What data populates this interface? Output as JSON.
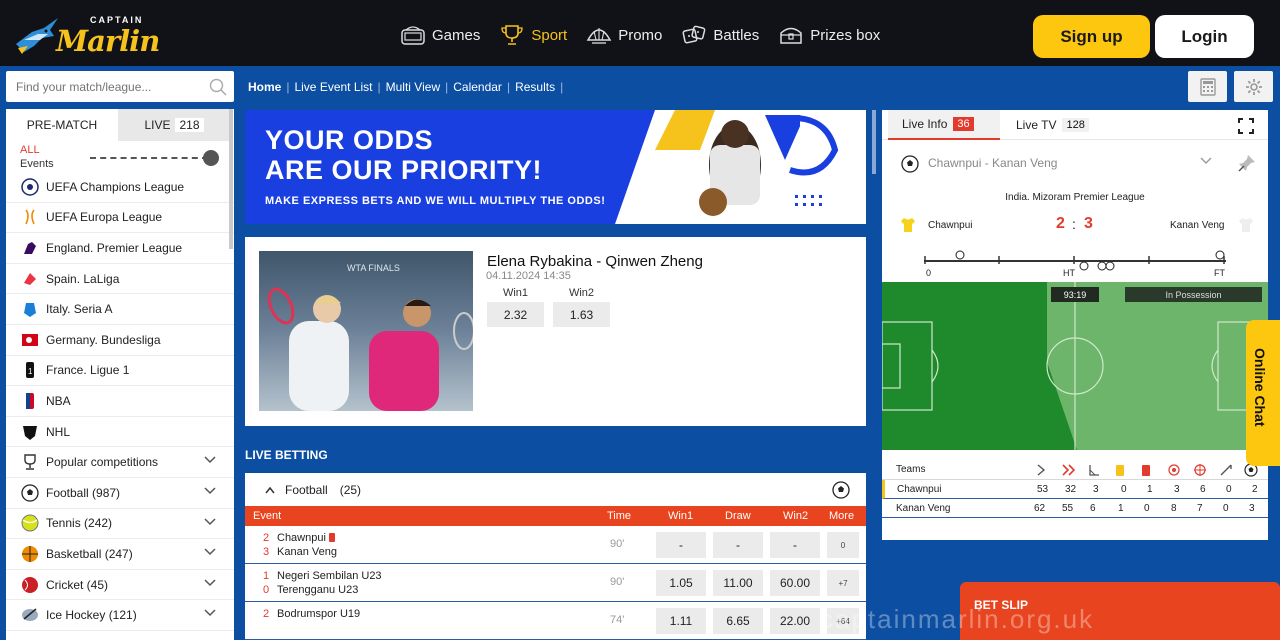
{
  "brand": {
    "top": "CAPTAIN",
    "main": "Marlin"
  },
  "nav": [
    {
      "label": "Games",
      "icon": "slot-machine-icon"
    },
    {
      "label": "Sport",
      "icon": "trophy-icon",
      "active": true
    },
    {
      "label": "Promo",
      "icon": "shell-icon"
    },
    {
      "label": "Battles",
      "icon": "dice-icon"
    },
    {
      "label": "Prizes box",
      "icon": "chest-icon"
    }
  ],
  "auth": {
    "signup": "Sign up",
    "login": "Login"
  },
  "search": {
    "placeholder": "Find your match/league..."
  },
  "sidebar": {
    "tabs": {
      "prematch": "PRE-MATCH",
      "live": "LIVE",
      "live_count": "218"
    },
    "all": "ALL",
    "events": "Events",
    "items": [
      {
        "label": "UEFA Champions League",
        "icon": "champions-league-icon"
      },
      {
        "label": "UEFA Europa League",
        "icon": "europa-league-icon"
      },
      {
        "label": "England. Premier League",
        "icon": "premier-league-icon"
      },
      {
        "label": "Spain. LaLiga",
        "icon": "laliga-icon"
      },
      {
        "label": "Italy. Seria A",
        "icon": "serie-a-icon"
      },
      {
        "label": "Germany. Bundesliga",
        "icon": "bundesliga-icon"
      },
      {
        "label": "France. Ligue 1",
        "icon": "ligue1-icon"
      },
      {
        "label": "NBA",
        "icon": "nba-icon"
      },
      {
        "label": "NHL",
        "icon": "nhl-icon"
      },
      {
        "label": "Popular competitions",
        "icon": "trophy-icon",
        "chevron": true
      },
      {
        "label": "Football (987)",
        "icon": "football-icon",
        "chevron": true
      },
      {
        "label": "Tennis (242)",
        "icon": "tennis-icon",
        "chevron": true
      },
      {
        "label": "Basketball (247)",
        "icon": "basketball-icon",
        "chevron": true
      },
      {
        "label": "Cricket (45)",
        "icon": "cricket-icon",
        "chevron": true
      },
      {
        "label": "Ice Hockey (121)",
        "icon": "hockey-icon",
        "chevron": true
      }
    ]
  },
  "breadcrumb": [
    "Home",
    "Live Event List",
    "Multi View",
    "Calendar",
    "Results"
  ],
  "banner": {
    "line1": "YOUR ODDS",
    "line2": "ARE OUR PRIORITY!",
    "line3": "MAKE EXPRESS BETS AND WE WILL MULTIPLY THE ODDS!"
  },
  "featured": {
    "title": "Elena Rybakina - Qinwen Zheng",
    "date": "04.11.2024 14:35",
    "photo_text": "WTA FINALS",
    "win1_label": "Win1",
    "win1": "2.32",
    "win2_label": "Win2",
    "win2": "1.63"
  },
  "live_betting": {
    "title": "LIVE BETTING",
    "group": "Football",
    "group_count": "(25)",
    "columns": {
      "event": "Event",
      "time": "Time",
      "win1": "Win1",
      "draw": "Draw",
      "win2": "Win2",
      "more": "More"
    },
    "rows": [
      {
        "s1": "2",
        "t1": "Chawnpui",
        "s2": "3",
        "t2": "Kanan Veng",
        "time": "90'",
        "win1": "-",
        "draw": "-",
        "win2": "-",
        "more": "0",
        "redcard": true
      },
      {
        "s1": "1",
        "t1": "Negeri Sembilan U23",
        "s2": "0",
        "t2": "Terengganu U23",
        "time": "90'",
        "win1": "1.05",
        "draw": "11.00",
        "win2": "60.00",
        "more": "+7"
      },
      {
        "s1": "2",
        "t1": "Bodrumspor U19",
        "s2": "",
        "t2": "",
        "time": "74'",
        "win1": "1.11",
        "draw": "6.65",
        "win2": "22.00",
        "more": "+64"
      }
    ]
  },
  "right_panel": {
    "tab_info": "Live Info",
    "tab_info_count": "36",
    "tab_tv": "Live TV",
    "tab_tv_count": "128",
    "match_select": "Chawnpui - Kanan Veng",
    "league": "India. Mizoram Premier League",
    "home": "Chawnpui",
    "away": "Kanan Veng",
    "score_home": "2",
    "score_away": "3",
    "timeline": {
      "start": "0",
      "ht": "HT",
      "ft": "FT"
    },
    "clock": "93:19",
    "possession": "In Possession",
    "stats": {
      "teams_label": "Teams",
      "rows": [
        {
          "team": "Chawnpui",
          "vals": [
            "53",
            "32",
            "3",
            "0",
            "1",
            "3",
            "6",
            "0",
            "2"
          ]
        },
        {
          "team": "Kanan Veng",
          "vals": [
            "62",
            "55",
            "6",
            "1",
            "0",
            "8",
            "7",
            "0",
            "3"
          ]
        }
      ]
    }
  },
  "chat": "Online Chat",
  "betslip": "BET SLIP",
  "watermark": "captainmarlin.org.uk",
  "colors": {
    "accent": "#fcc70e",
    "bg_blue": "#0b4ea2",
    "live_red": "#e8441f"
  }
}
